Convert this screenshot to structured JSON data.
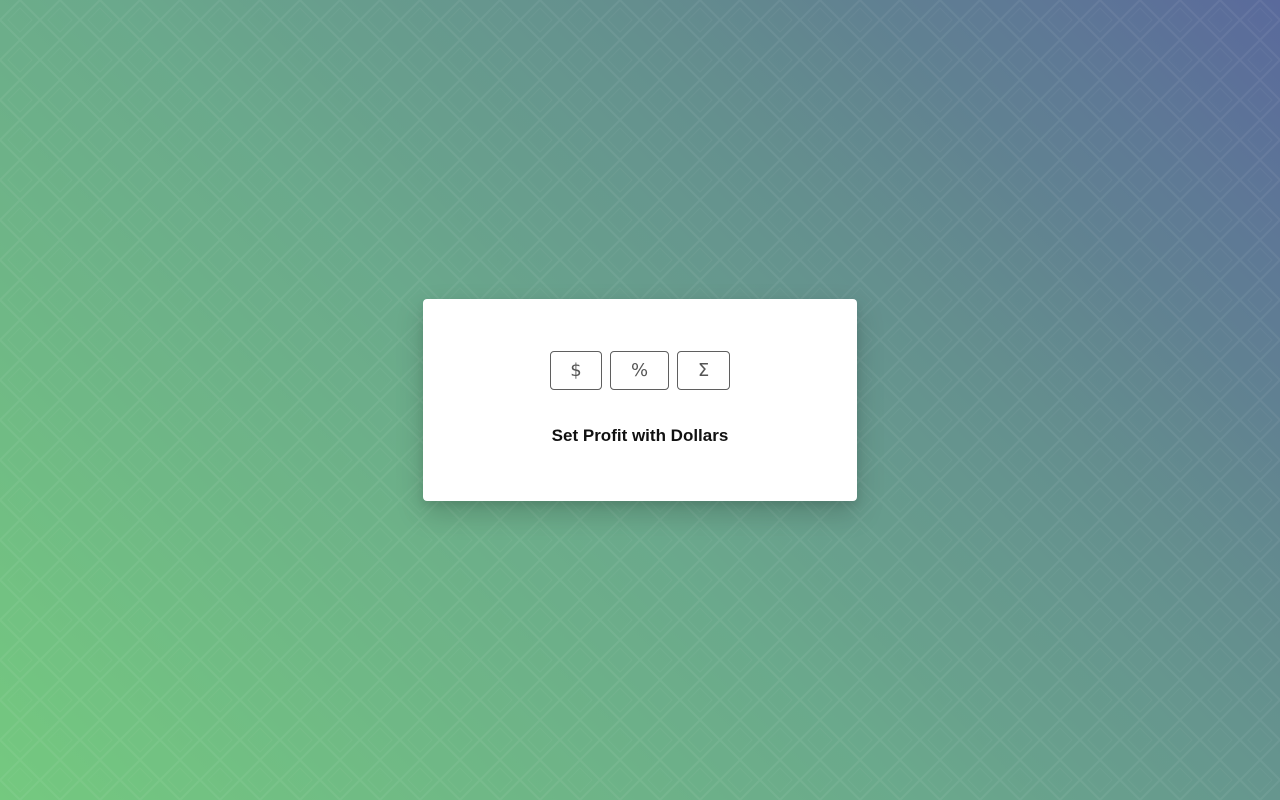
{
  "card": {
    "buttons": [
      {
        "label": "$",
        "icon": "dollar-icon"
      },
      {
        "label": "%",
        "icon": "percent-icon"
      },
      {
        "label": "Σ",
        "icon": "sigma-icon"
      }
    ],
    "instruction": "Set Profit with Dollars"
  },
  "colors": {
    "background_start": "#74c97f",
    "background_end": "#5a6a9c",
    "card": "#ffffff",
    "button_border": "#5f5f5f",
    "text": "#111111"
  }
}
